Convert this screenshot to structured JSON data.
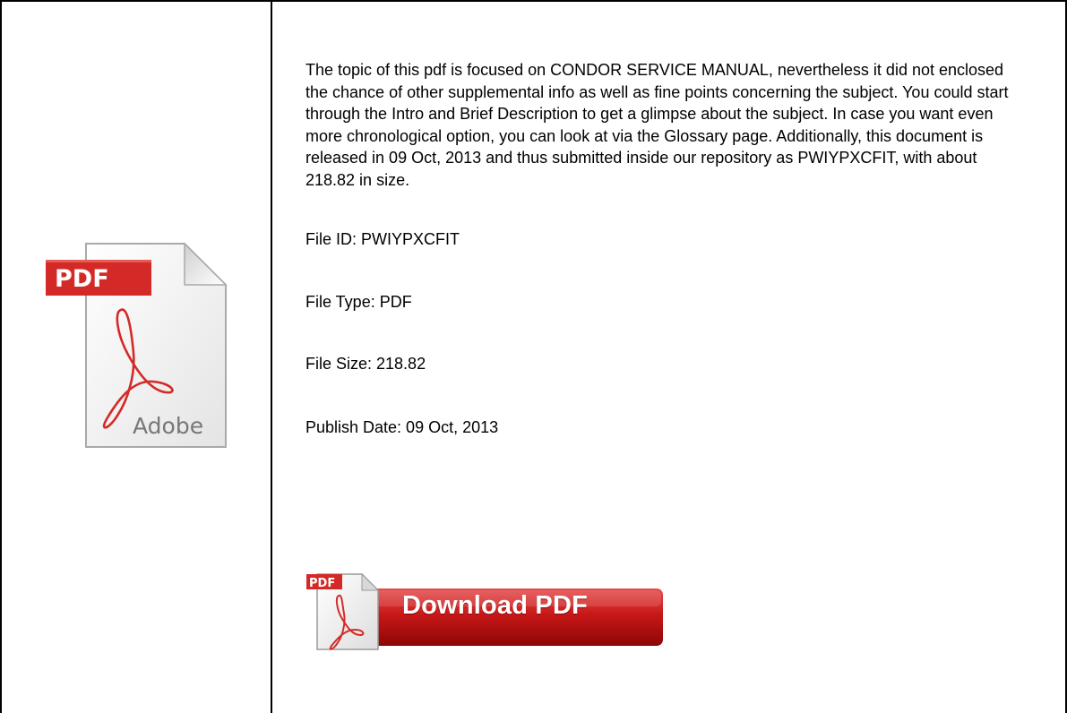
{
  "description": "The topic of this pdf is focused on CONDOR SERVICE MANUAL, nevertheless it did not enclosed the chance of other supplemental info as well as fine points concerning the subject. You could start through the Intro and Brief Description to get a glimpse about the subject. In case you want even more chronological option, you can look at via the Glossary page. Additionally, this document is released in 09 Oct, 2013 and thus submitted inside our repository as PWIYPXCFIT, with about 218.82 in size.",
  "file_id": "File ID: PWIYPXCFIT",
  "file_type": "File Type: PDF",
  "file_size": "File Size: 218.82",
  "publish_date": "Publish Date: 09 Oct, 2013",
  "pdf_icon": {
    "label": "PDF",
    "brand": "Adobe",
    "icon": "adobe-pdf-document-icon"
  },
  "download_button": {
    "label": "Download PDF",
    "badge": "PDF",
    "icon": "adobe-pdf-icon"
  },
  "colors": {
    "pdf_red": "#d42a27",
    "button_red": "#c01414",
    "text": "#000000",
    "border": "#000000"
  }
}
